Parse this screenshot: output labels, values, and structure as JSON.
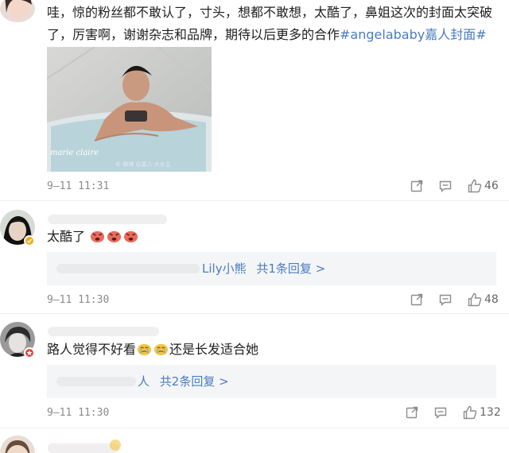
{
  "comments": [
    {
      "text": "哇，惊的粉丝都不敢认了，寸头，想都不敢想，太酷了，鼻姐这次的封面太突破了，厉害啊，谢谢杂志和品牌，期待以后更多的合作",
      "hashtag": "#angelababy嘉人封面#",
      "image": {
        "brand": "marie claire",
        "watermark": "© 微博 @嘉人·大女主"
      },
      "timestamp": "9–11 11:31",
      "likes": "46"
    },
    {
      "text": "太酷了",
      "reply_preview_name": "Lily小熊",
      "reply_count_label": "共1条回复 >",
      "timestamp": "9–11 11:30",
      "likes": "48"
    },
    {
      "text_before": "路人觉得不好看",
      "text_after": "还是长发适合她",
      "reply_preview_name": "人",
      "reply_count_label": "共2条回复 >",
      "timestamp": "9–11 11:30",
      "likes": "132"
    }
  ],
  "icons": {
    "share": "share-icon",
    "comment": "comment-icon",
    "like": "thumbs-up-icon",
    "verified": "verified-badge-icon",
    "emoji_angry": "angry-face-emoji",
    "emoji_cry": "crying-face-emoji"
  },
  "colors": {
    "link": "#4a7cc2",
    "meta": "#8b8b8b",
    "reply_bg": "#f4f5f6",
    "badge_gold": "#f0a81c",
    "badge_red": "#e0433a"
  }
}
